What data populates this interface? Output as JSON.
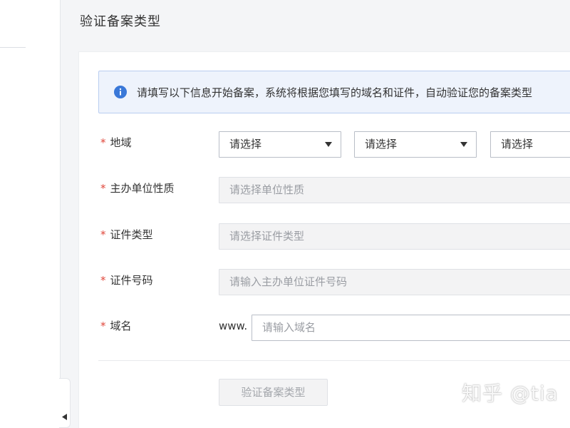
{
  "page": {
    "title": "验证备案类型"
  },
  "notice": {
    "icon": "info-icon",
    "text": "请填写以下信息开始备案，系统将根据您填写的域名和证件，自动验证您的备案类型",
    "accent": "#3a78d8"
  },
  "form": {
    "required_mark": "*",
    "region": {
      "label": "地域",
      "selects": [
        "请选择",
        "请选择",
        "请选择"
      ]
    },
    "org_type": {
      "label": "主办单位性质",
      "placeholder": "请选择单位性质"
    },
    "cert_type": {
      "label": "证件类型",
      "placeholder": "请选择证件类型"
    },
    "cert_number": {
      "label": "证件号码",
      "placeholder": "请输入主办单位证件号码"
    },
    "domain": {
      "label": "域名",
      "prefix": "www.",
      "placeholder": "请输入域名"
    }
  },
  "actions": {
    "verify_label": "验证备案类型"
  },
  "watermark": {
    "text": "知乎 @tia"
  },
  "colors": {
    "required": "#e0473b",
    "notice_bg": "#eef3fc",
    "notice_border": "#b9cdf0"
  }
}
